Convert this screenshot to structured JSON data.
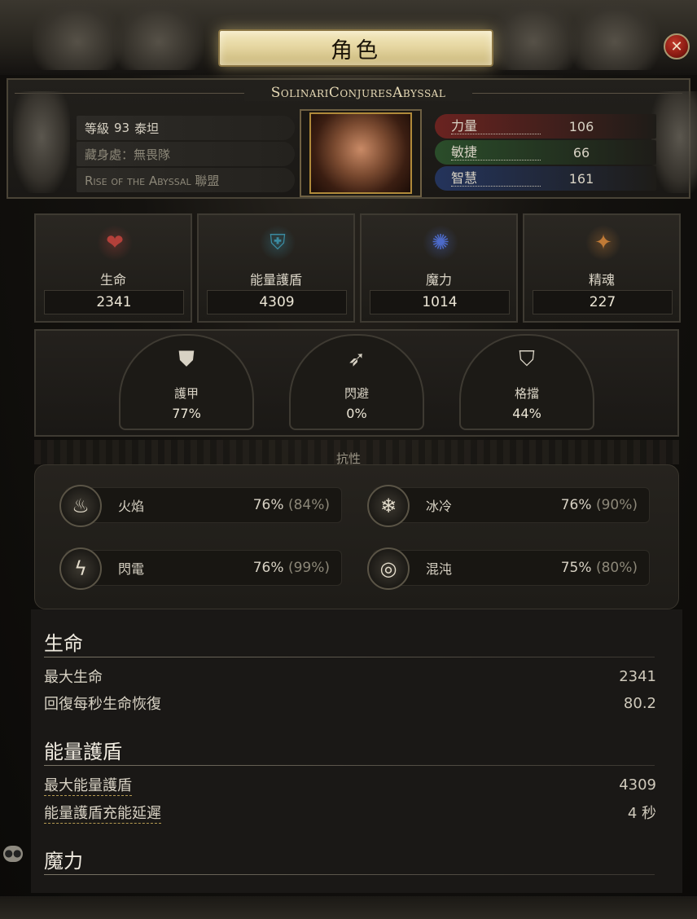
{
  "window": {
    "title": "角色",
    "close_icon": "close-icon"
  },
  "character": {
    "name": "SolinariConjuresAbyssal",
    "level_label": "等級",
    "level": "93",
    "class": "泰坦",
    "hideout": "藏身處：無畏隊",
    "league": "Rise of the Abyssal 聯盟"
  },
  "attributes": [
    {
      "label": "力量",
      "value": "106",
      "color": "#6a2320"
    },
    {
      "label": "敏捷",
      "value": "66",
      "color": "#2a4d2a"
    },
    {
      "label": "智慧",
      "value": "161",
      "color": "#24345c"
    }
  ],
  "main_stats": [
    {
      "label": "生命",
      "value": "2341",
      "icon": "heart-icon",
      "color": "#b3403a"
    },
    {
      "label": "能量護盾",
      "value": "4309",
      "icon": "shield-icon",
      "color": "#3a8aa0"
    },
    {
      "label": "魔力",
      "value": "1014",
      "icon": "mana-icon",
      "color": "#4c6ac8"
    },
    {
      "label": "精魂",
      "value": "227",
      "icon": "spirit-icon",
      "color": "#c07a36"
    }
  ],
  "defenses": [
    {
      "label": "護甲",
      "value": "77%",
      "icon": "armour-icon"
    },
    {
      "label": "閃避",
      "value": "0%",
      "icon": "evasion-icon"
    },
    {
      "label": "格擋",
      "value": "44%",
      "icon": "block-icon"
    }
  ],
  "resistances": {
    "title": "抗性",
    "items": [
      {
        "label": "火焰",
        "value": "76%",
        "cap": "(84%)",
        "icon": "fire-icon"
      },
      {
        "label": "冰冷",
        "value": "76%",
        "cap": "(90%)",
        "icon": "cold-icon"
      },
      {
        "label": "閃電",
        "value": "76%",
        "cap": "(99%)",
        "icon": "lightning-icon"
      },
      {
        "label": "混沌",
        "value": "75%",
        "cap": "(80%)",
        "icon": "chaos-icon"
      }
    ]
  },
  "stat_sections": [
    {
      "title": "生命",
      "rows": [
        {
          "label": "最大生命",
          "value": "2341"
        },
        {
          "label": "回復每秒生命恢復",
          "value": "80.2"
        }
      ]
    },
    {
      "title": "能量護盾",
      "rows": [
        {
          "label": "最大能量護盾",
          "value": "4309"
        },
        {
          "label": "能量護盾充能延遲",
          "value": "4 秒"
        }
      ]
    },
    {
      "title": "魔力",
      "rows": []
    }
  ],
  "chat_icon": "chat-bubble-icon"
}
